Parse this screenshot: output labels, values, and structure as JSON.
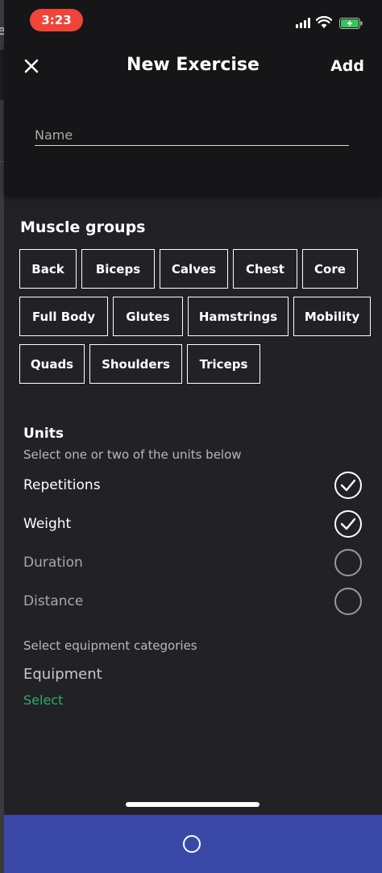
{
  "status": {
    "time": "3:23"
  },
  "header": {
    "title": "New Exercise",
    "add_label": "Add",
    "name_placeholder": "Name"
  },
  "muscle_groups": {
    "title": "Muscle groups",
    "rows": [
      [
        "Back",
        "Biceps",
        "Calves",
        "Chest",
        "Core"
      ],
      [
        "Full Body",
        "Glutes",
        "Hamstrings",
        "Mobility"
      ],
      [
        "Quads",
        "Shoulders",
        "Triceps"
      ]
    ]
  },
  "units": {
    "title": "Units",
    "subtitle": "Select one or two of the units below",
    "items": [
      {
        "label": "Repetitions",
        "checked": true
      },
      {
        "label": "Weight",
        "checked": true
      },
      {
        "label": "Duration",
        "checked": false
      },
      {
        "label": "Distance",
        "checked": false
      }
    ]
  },
  "equipment": {
    "subtitle": "Select equipment categories",
    "title": "Equipment",
    "select_label": "Select"
  },
  "colors": {
    "accent_green": "#2fae6a",
    "bottom_bar": "#3a49a8",
    "time_pill": "#f0443a"
  }
}
